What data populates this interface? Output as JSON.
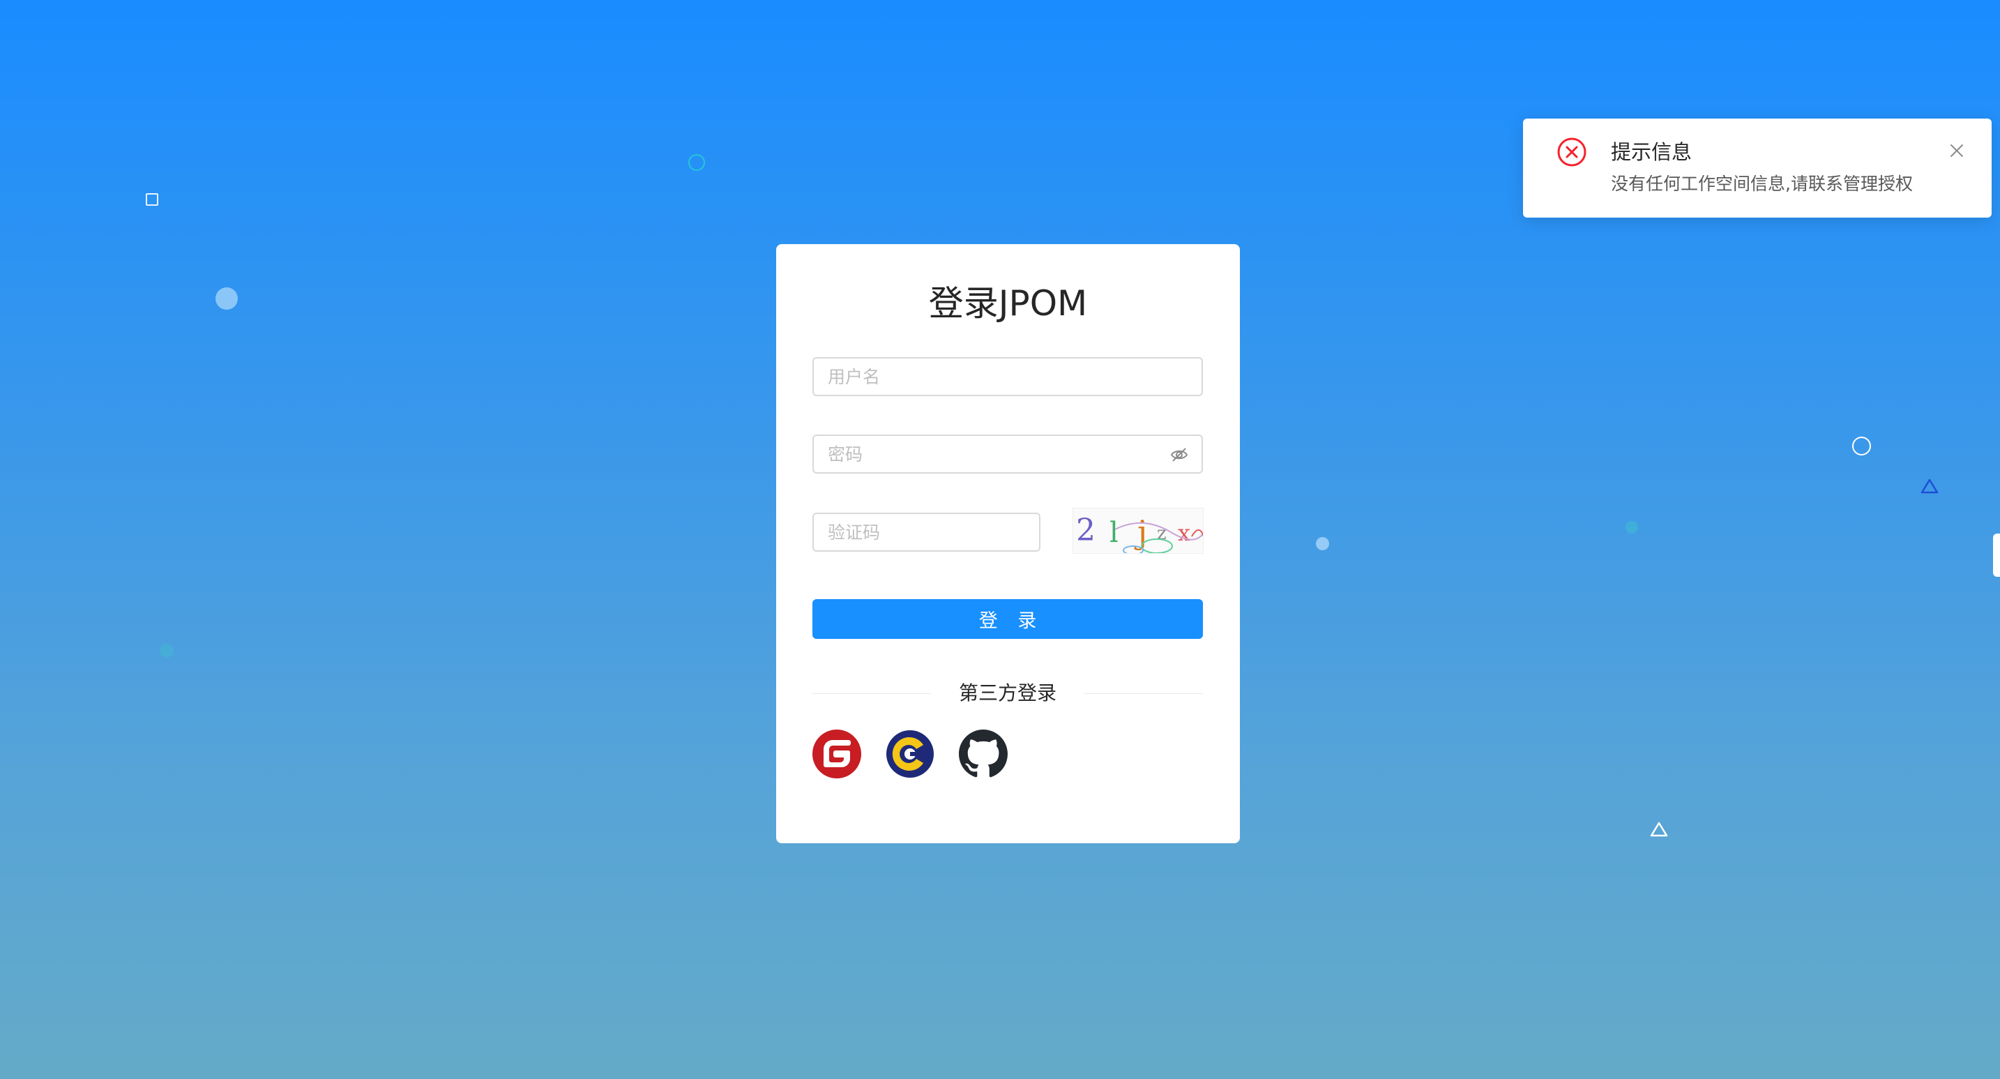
{
  "login": {
    "title": "登录JPOM",
    "username_placeholder": "用户名",
    "password_placeholder": "密码",
    "captcha_placeholder": "验证码",
    "captcha_text": "2lj",
    "submit_label": "登 录",
    "third_party_label": "第三方登录",
    "oauth_providers": [
      "gitee-icon",
      "maxkey-icon",
      "github-icon"
    ]
  },
  "notification": {
    "type": "error",
    "title": "提示信息",
    "message": "没有任何工作空间信息,请联系管理授权"
  },
  "colors": {
    "primary": "#1890ff",
    "error": "#f5222d",
    "background_top": "#1a8cff",
    "background_bottom": "#64aac8"
  }
}
